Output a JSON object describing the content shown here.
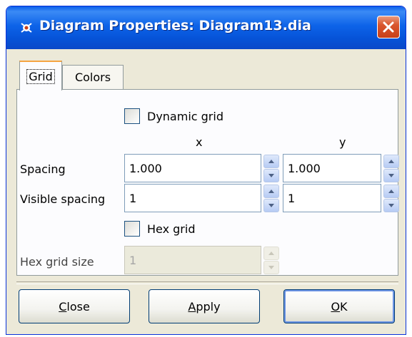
{
  "window": {
    "title": "Diagram Properties: Diagram13.dia"
  },
  "tabs": [
    {
      "label": "Grid",
      "active": true
    },
    {
      "label": "Colors",
      "active": false
    }
  ],
  "grid": {
    "dynamic_grid_label": "Dynamic grid",
    "dynamic_grid_checked": false,
    "col_x": "x",
    "col_y": "y",
    "spacing_label": "Spacing",
    "spacing_x": "1.000",
    "spacing_y": "1.000",
    "visible_spacing_label": "Visible spacing",
    "visible_spacing_x": "1",
    "visible_spacing_y": "1",
    "hex_grid_label": "Hex grid",
    "hex_grid_checked": false,
    "hex_grid_size_label": "Hex grid size",
    "hex_grid_size_value": "1"
  },
  "buttons": {
    "close_mnemonic": "C",
    "close_rest": "lose",
    "apply_mnemonic": "A",
    "apply_rest": "pply",
    "ok_mnemonic": "O",
    "ok_rest": "K"
  },
  "colors": {
    "titlebar": "#0a5ee9",
    "close_button": "#d9562e",
    "active_tab_accent": "#f5a442",
    "dialog_bg": "#ece9d8"
  }
}
